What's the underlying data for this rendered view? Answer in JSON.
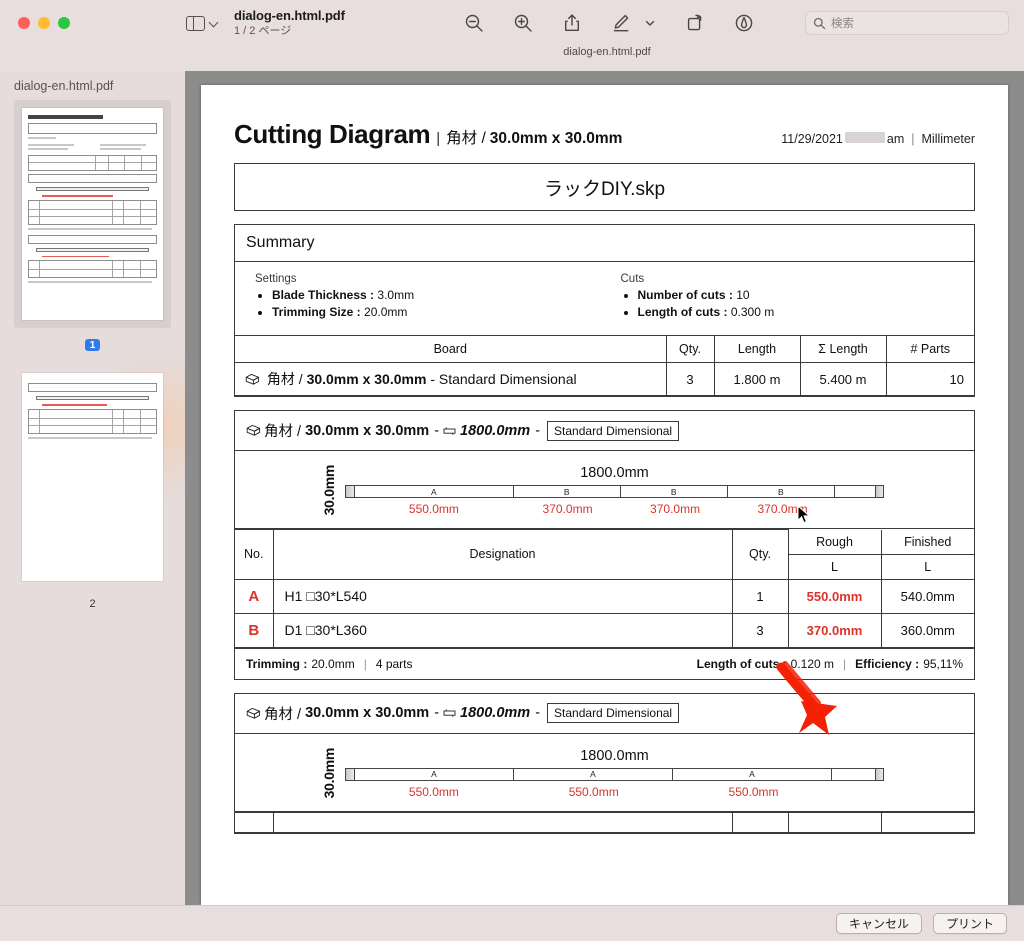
{
  "window": {
    "traffic_lights": [
      "close",
      "minimize",
      "maximize"
    ],
    "sidebar_toggle_icon": "sidebar-icon",
    "file_name": "dialog-en.html.pdf",
    "page_indicator": "1 / 2 ページ",
    "subtitle": "dialog-en.html.pdf",
    "toolbar_icons": [
      "zoom-out-icon",
      "zoom-in-icon",
      "share-icon",
      "markup-icon",
      "chevron-down-icon",
      "rotate-icon",
      "annotate-icon"
    ],
    "search": {
      "placeholder": "検索",
      "value": "",
      "icon": "search-icon"
    }
  },
  "sidebar": {
    "header": "dialog-en.html.pdf",
    "thumbnails": [
      {
        "label": "1",
        "selected": true
      },
      {
        "label": "2",
        "selected": false
      }
    ]
  },
  "document": {
    "title": "Cutting Diagram",
    "title_separator": "|",
    "subtitle_material": "角材 /",
    "subtitle_dims": "30.0mm x 30.0mm",
    "date": "11/29/2021",
    "time_redacted": "",
    "meridiem": "am",
    "meta_separator": "|",
    "unit": "Millimeter",
    "file_name": "ラックDIY.skp",
    "summary": {
      "title": "Summary",
      "settings_heading": "Settings",
      "settings": [
        {
          "label": "Blade Thickness :",
          "value": "3.0mm"
        },
        {
          "label": "Trimming Size :",
          "value": "20.0mm"
        }
      ],
      "cuts_heading": "Cuts",
      "cuts": [
        {
          "label": "Number of cuts :",
          "value": "10"
        },
        {
          "label": "Length of cuts :",
          "value": "0.300 m"
        }
      ],
      "board_table": {
        "headers": [
          "Board",
          "Qty.",
          "Length",
          "Σ Length",
          "# Parts"
        ],
        "rows": [
          {
            "board_material": "角材 /",
            "board_dims": "30.0mm x 30.0mm",
            "board_suffix": "- Standard Dimensional",
            "qty": "3",
            "length": "1.800 m",
            "sum_length": "5.400 m",
            "parts": "10"
          }
        ]
      }
    },
    "sections": [
      {
        "head_material": "角材 /",
        "head_dims": "30.0mm x 30.0mm",
        "head_dash1": "-",
        "head_length": "1800.0mm",
        "head_dash2": "-",
        "head_tag": "Standard Dimensional",
        "diagram": {
          "width_label": "1800.0mm",
          "height_label": "30.0mm",
          "total_mm": 1800,
          "segments": [
            {
              "letter": "A",
              "mm": 550,
              "label": "550.0mm"
            },
            {
              "letter": "B",
              "mm": 370,
              "label": "370.0mm"
            },
            {
              "letter": "B",
              "mm": 370,
              "label": "370.0mm"
            },
            {
              "letter": "B",
              "mm": 370,
              "label": "370.0mm"
            }
          ],
          "offcut_mm": 140
        },
        "parts_table": {
          "headers": {
            "no": "No.",
            "designation": "Designation",
            "qty": "Qty.",
            "rough": "Rough",
            "finished": "Finished",
            "rough_sub": "L",
            "finished_sub": "L"
          },
          "rows": [
            {
              "no": "A",
              "designation": "H1 □30*L540",
              "qty": "1",
              "rough": "550.0mm",
              "finished": "540.0mm"
            },
            {
              "no": "B",
              "designation": "D1 □30*L360",
              "qty": "3",
              "rough": "370.0mm",
              "finished": "360.0mm"
            }
          ]
        },
        "footer": {
          "trimming_label": "Trimming :",
          "trimming_value": "20.0mm",
          "parts_count": "4 parts",
          "cuts_label": "Length of cuts :",
          "cuts_value": "0.120 m",
          "efficiency_label": "Efficiency :",
          "efficiency_value": "95,11%"
        }
      },
      {
        "head_material": "角材 /",
        "head_dims": "30.0mm x 30.0mm",
        "head_dash1": "-",
        "head_length": "1800.0mm",
        "head_dash2": "-",
        "head_tag": "Standard Dimensional",
        "diagram": {
          "width_label": "1800.0mm",
          "height_label": "30.0mm",
          "total_mm": 1800,
          "segments": [
            {
              "letter": "A",
              "mm": 550,
              "label": "550.0mm"
            },
            {
              "letter": "A",
              "mm": 550,
              "label": "550.0mm"
            },
            {
              "letter": "A",
              "mm": 550,
              "label": "550.0mm"
            }
          ],
          "offcut_mm": 150
        }
      }
    ],
    "annotation": {
      "type": "red-arrow",
      "color": "#f52105"
    }
  },
  "footer": {
    "cancel_label": "キャンセル",
    "print_label": "プリント"
  }
}
